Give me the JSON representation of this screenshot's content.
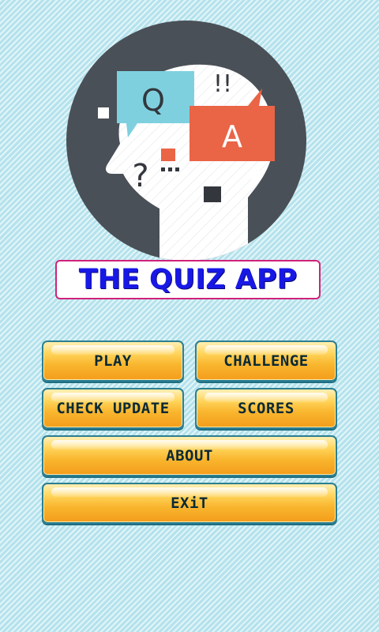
{
  "app": {
    "title": "THE QUIZ APP"
  },
  "logo": {
    "icon": "head-quiz-icon",
    "q_letter": "Q",
    "a_letter": "A",
    "exclaim": "!!",
    "question_mark": "?",
    "colors": {
      "circle": "#4a5057",
      "q_bubble": "#7fd0df",
      "a_bubble": "#ea6446",
      "head": "#ffffff"
    }
  },
  "menu": {
    "play": "PLAY",
    "challenge": "CHALLENGE",
    "check_update": "CHECK UPDATE",
    "scores": "SCORES",
    "about": "ABOUT",
    "exit": "EXiT"
  },
  "colors": {
    "background": "#bfe8f0",
    "title_text": "#1818e6",
    "title_border": "#d0227a",
    "button_top": "#ffd45a",
    "button_bottom": "#f39d1b",
    "button_border": "#2b7f92"
  }
}
